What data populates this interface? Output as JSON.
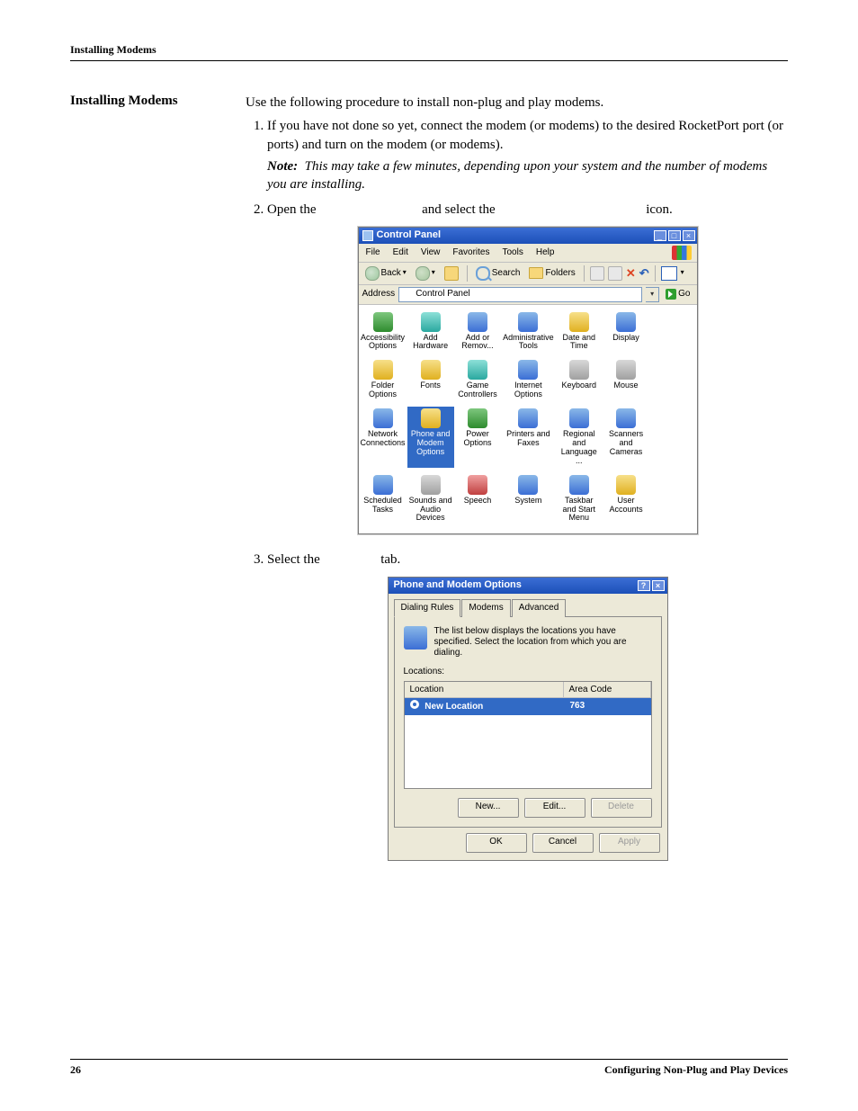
{
  "doc": {
    "running_head": "Installing Modems",
    "section_heading": "Installing Modems",
    "intro": "Use the following procedure to install non-plug and play modems.",
    "step1": "If you have not done so yet, connect the modem (or modems) to the desired RocketPort port (or ports) and turn on the modem (or modems).",
    "note_label": "Note:",
    "note_body": "This may take a few minutes, depending upon your system and the number of modems you are installing.",
    "step2_a": "Open the",
    "step2_b": "and select the",
    "step2_c": "icon.",
    "step3_a": "Select the",
    "step3_b": "tab.",
    "page_number": "26",
    "footer_right": "Configuring Non-Plug and Play Devices"
  },
  "cp": {
    "title": "Control Panel",
    "menu": [
      "File",
      "Edit",
      "View",
      "Favorites",
      "Tools",
      "Help"
    ],
    "back_label": "Back",
    "search_label": "Search",
    "folders_label": "Folders",
    "address_label": "Address",
    "address_value": "Control Panel",
    "go_label": "Go",
    "items": [
      {
        "label": "Accessibility Options",
        "ic": "ic-green"
      },
      {
        "label": "Add Hardware",
        "ic": "ic-teal"
      },
      {
        "label": "Add or Remov...",
        "ic": "ic-blue"
      },
      {
        "label": "Administrative Tools",
        "ic": "ic-blue"
      },
      {
        "label": "Date and Time",
        "ic": "ic-yellow"
      },
      {
        "label": "Display",
        "ic": "ic-blue"
      },
      {
        "label": "",
        "ic": ""
      },
      {
        "label": "Folder Options",
        "ic": "ic-yellow"
      },
      {
        "label": "Fonts",
        "ic": "ic-yellow"
      },
      {
        "label": "Game Controllers",
        "ic": "ic-teal"
      },
      {
        "label": "Internet Options",
        "ic": "ic-blue"
      },
      {
        "label": "Keyboard",
        "ic": "ic-gray"
      },
      {
        "label": "Mouse",
        "ic": "ic-gray"
      },
      {
        "label": "",
        "ic": ""
      },
      {
        "label": "Network Connections",
        "ic": "ic-blue"
      },
      {
        "label": "Phone and Modem Options",
        "ic": "ic-yellow",
        "selected": true
      },
      {
        "label": "Power Options",
        "ic": "ic-green"
      },
      {
        "label": "Printers and Faxes",
        "ic": "ic-blue"
      },
      {
        "label": "Regional and Language ...",
        "ic": "ic-blue"
      },
      {
        "label": "Scanners and Cameras",
        "ic": "ic-blue"
      },
      {
        "label": "",
        "ic": ""
      },
      {
        "label": "Scheduled Tasks",
        "ic": "ic-blue"
      },
      {
        "label": "Sounds and Audio Devices",
        "ic": "ic-gray"
      },
      {
        "label": "Speech",
        "ic": "ic-red"
      },
      {
        "label": "System",
        "ic": "ic-blue"
      },
      {
        "label": "Taskbar and Start Menu",
        "ic": "ic-blue"
      },
      {
        "label": "User Accounts",
        "ic": "ic-yellow"
      },
      {
        "label": "",
        "ic": ""
      }
    ]
  },
  "pm": {
    "title": "Phone and Modem Options",
    "tabs": [
      "Dialing Rules",
      "Modems",
      "Advanced"
    ],
    "desc": "The list below displays the locations you have specified. Select the location from which you are dialing.",
    "locations_label": "Locations:",
    "col_location": "Location",
    "col_area": "Area Code",
    "row_location": "New Location",
    "row_area": "763",
    "btn_new": "New...",
    "btn_edit": "Edit...",
    "btn_delete": "Delete",
    "btn_ok": "OK",
    "btn_cancel": "Cancel",
    "btn_apply": "Apply"
  }
}
